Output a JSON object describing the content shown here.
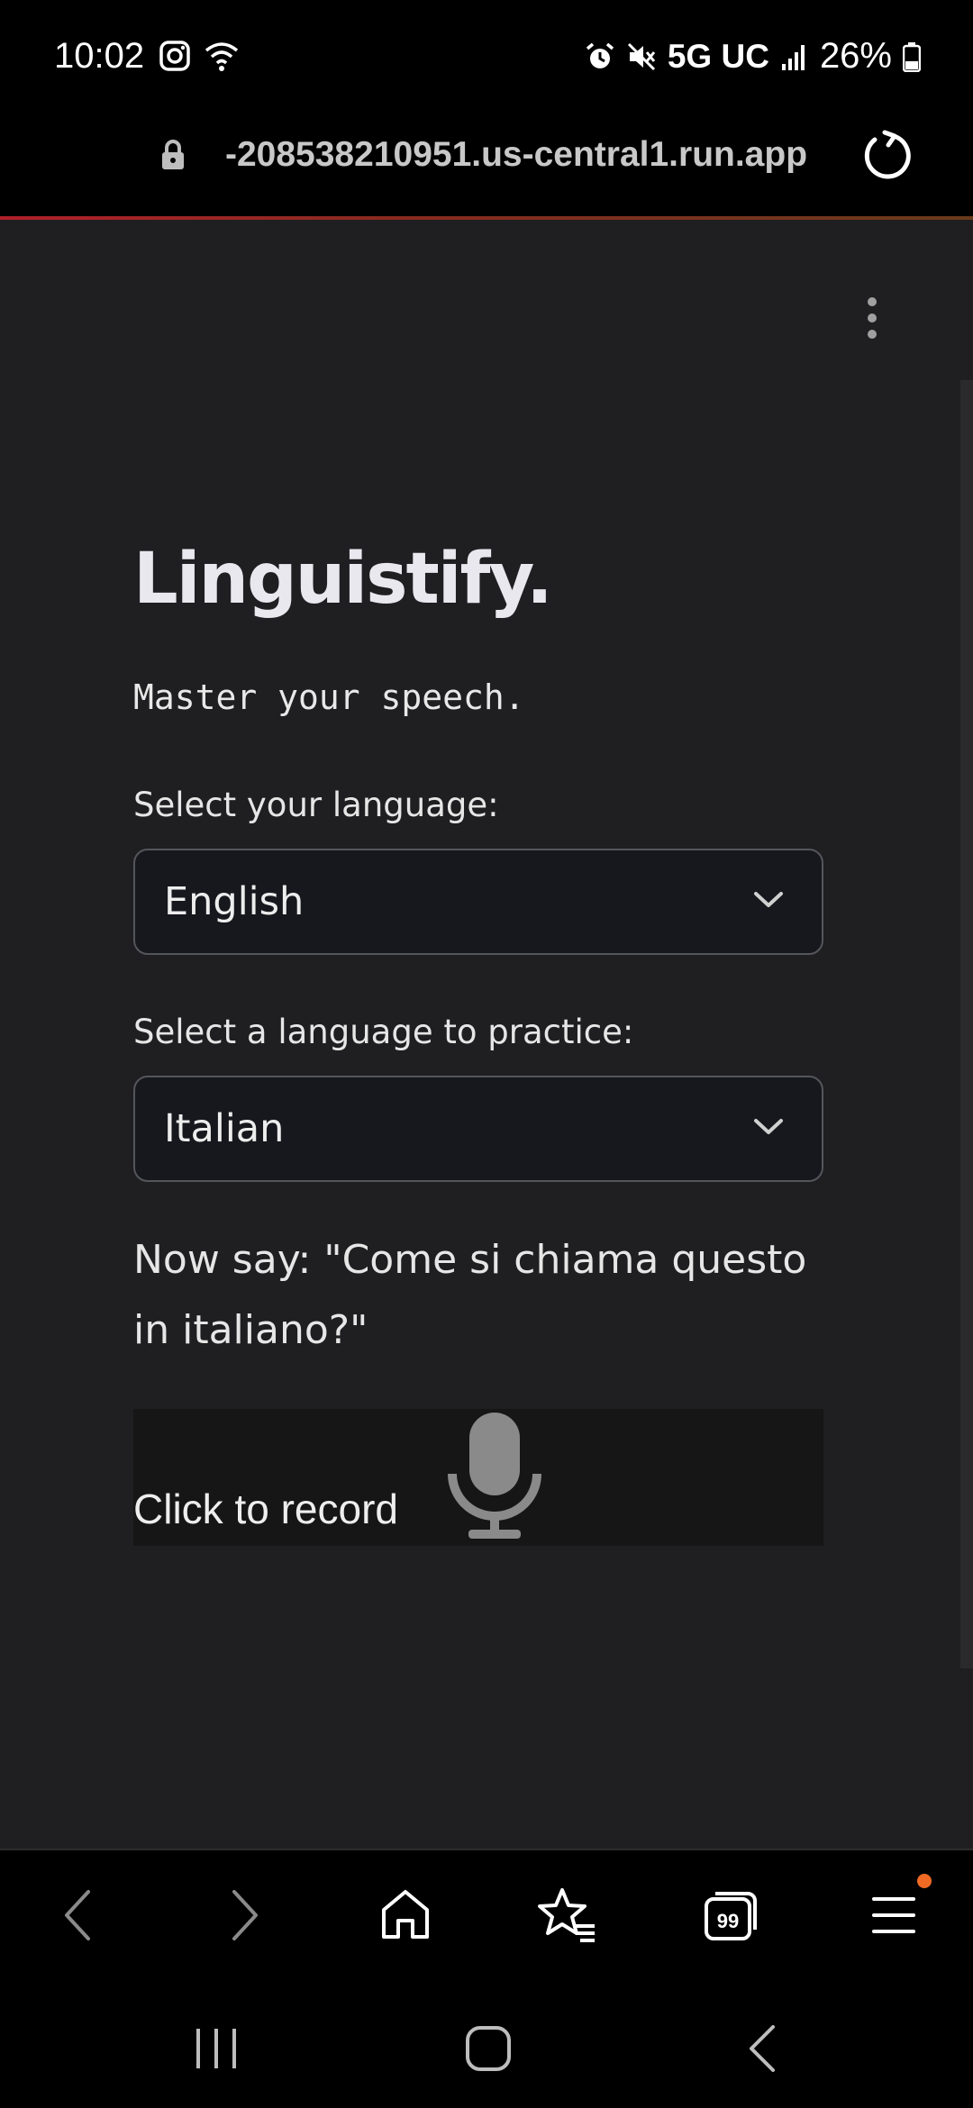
{
  "status": {
    "time": "10:02",
    "network": "5G UC",
    "battery": "26%"
  },
  "browser": {
    "url": "-208538210951.us-central1.run.app"
  },
  "app": {
    "title": "Linguistify.",
    "subtitle": "Master your speech.",
    "native_label": "Select your language:",
    "native_value": "English",
    "practice_label": "Select a language to practice:",
    "practice_value": "Italian",
    "prompt": "Now say: \"Come si chiama questo in italiano?\"",
    "record_label": "Click to record"
  },
  "icons": {
    "status": [
      "instagram-icon",
      "wifi-icon",
      "alarm-icon",
      "mute-icon",
      "signal-icon",
      "battery-icon"
    ],
    "browser": [
      "bookmark-star-icon",
      "lock-icon",
      "reload-icon"
    ],
    "app": [
      "more-options-icon",
      "chevron-down-icon",
      "microphone-icon"
    ],
    "browser_nav": [
      "back-icon",
      "forward-icon",
      "home-icon",
      "bookmarks-icon",
      "tabs-icon",
      "menu-icon"
    ],
    "system_nav": [
      "recents-icon",
      "home-button-icon",
      "system-back-icon"
    ]
  },
  "colors": {
    "app_background": "#1f1f21",
    "notification_dot": "#f06a24",
    "loading_bar": "#b0202a"
  }
}
